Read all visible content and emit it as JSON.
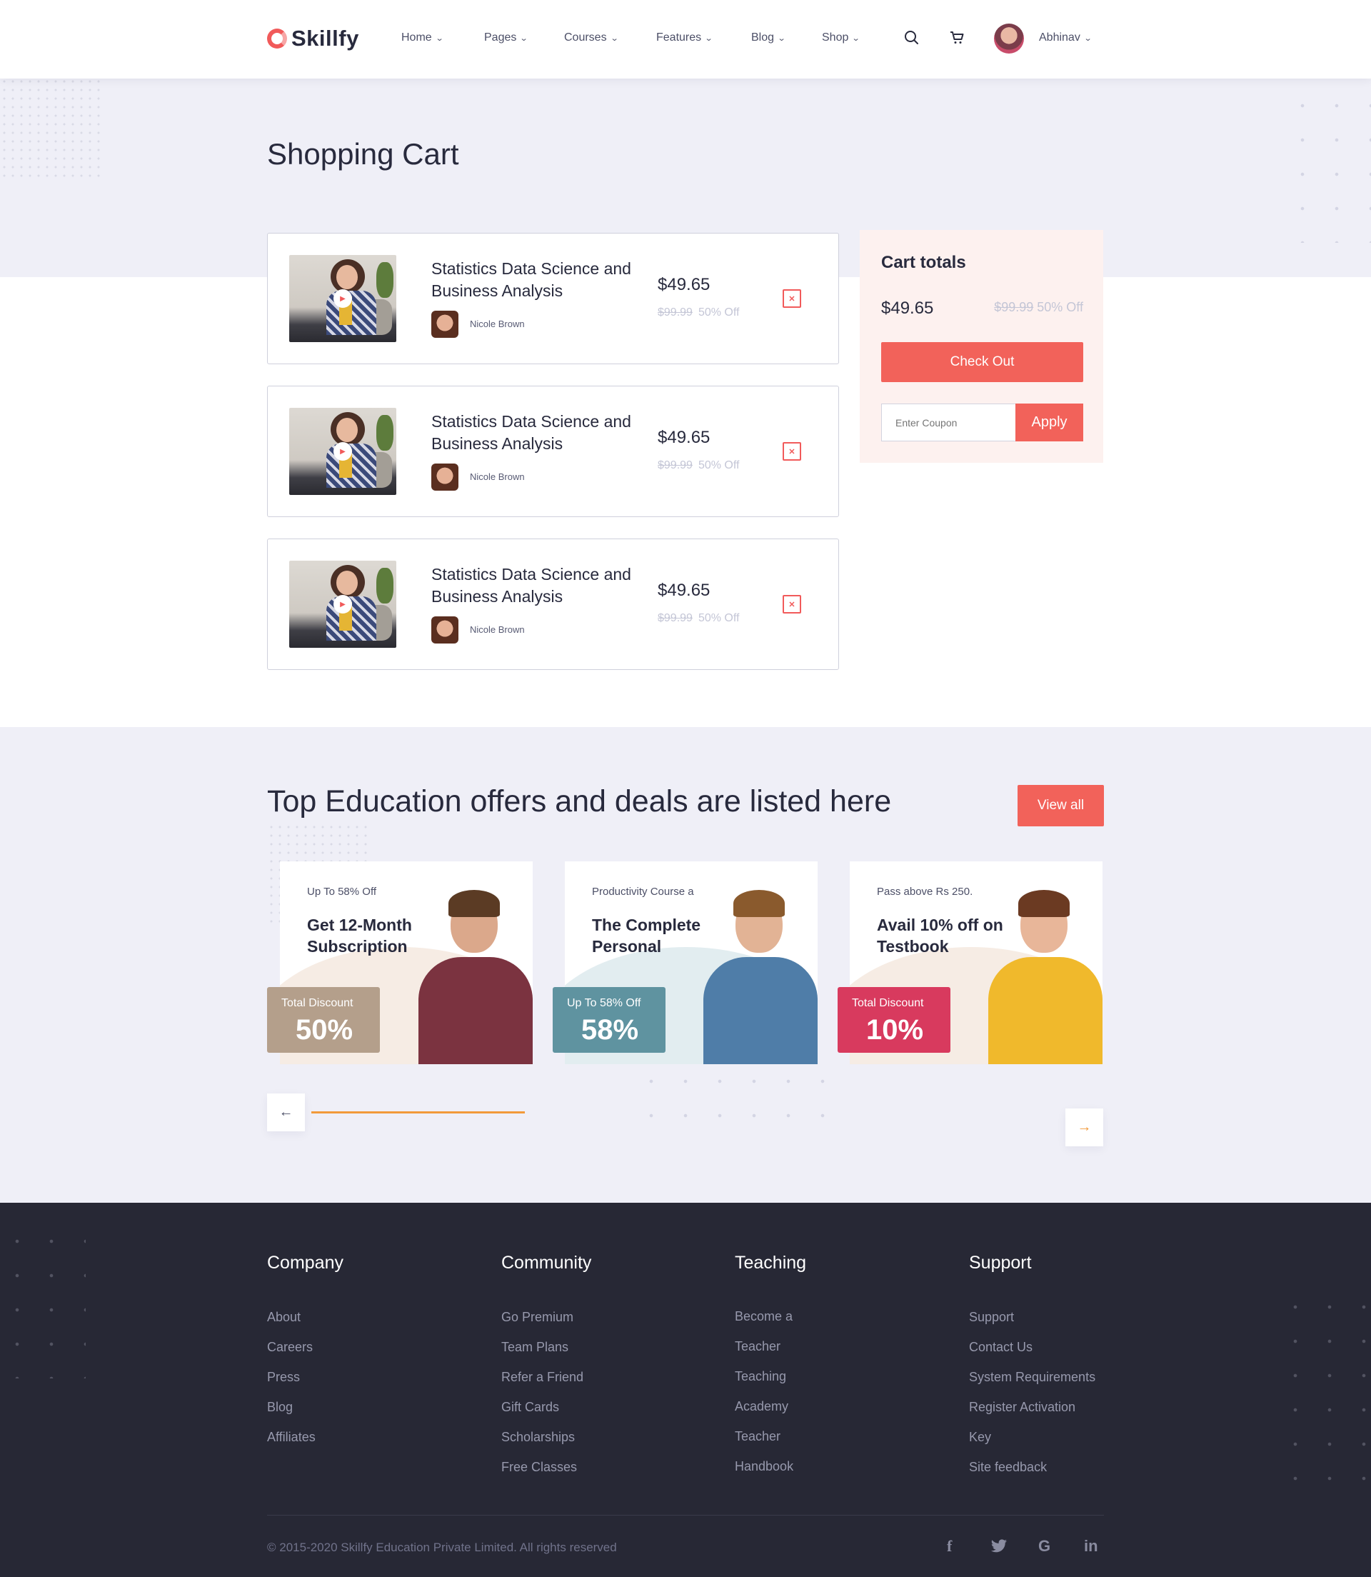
{
  "brand": {
    "name": "Skillfy",
    "accent": "#f2625a"
  },
  "nav": {
    "items": [
      {
        "label": "Home"
      },
      {
        "label": "Pages"
      },
      {
        "label": "Courses"
      },
      {
        "label": "Features"
      },
      {
        "label": "Blog"
      },
      {
        "label": "Shop"
      }
    ],
    "user_name": "Abhinav",
    "icons": [
      "search-icon",
      "cart-icon",
      "chevron-down-icon"
    ]
  },
  "page": {
    "title": "Shopping Cart"
  },
  "cart": {
    "items": [
      {
        "title": "Statistics Data Science and Business Analysis",
        "author": "Nicole Brown",
        "price": "$49.65",
        "old_price": "$99.99",
        "discount": "50% Off"
      },
      {
        "title": "Statistics Data Science and Business Analysis",
        "author": "Nicole Brown",
        "price": "$49.65",
        "old_price": "$99.99",
        "discount": "50% Off"
      },
      {
        "title": "Statistics Data Science and Business Analysis",
        "author": "Nicole Brown",
        "price": "$49.65",
        "old_price": "$99.99",
        "discount": "50% Off"
      }
    ],
    "remove_icon": "close-icon"
  },
  "totals": {
    "title": "Cart totals",
    "price": "$49.65",
    "old_price": "$99.99",
    "discount": "50% Off",
    "checkout_label": "Check Out",
    "coupon_placeholder": "Enter Coupon",
    "apply_label": "Apply"
  },
  "offers": {
    "title": "Top Education offers and deals are listed here",
    "view_all_label": "View all",
    "cards": [
      {
        "kicker": "Up To 58% Off",
        "headline": "Get 12-Month Subscription",
        "badge_label": "Total Discount",
        "badge_value": "50%",
        "badge_color": "#b49f8b"
      },
      {
        "kicker": "Productivity Course a",
        "headline": "The Complete Personal",
        "badge_label": "Up To 58% Off",
        "badge_value": "58%",
        "badge_color": "#5f93a0"
      },
      {
        "kicker": "Pass above Rs 250.",
        "headline": "Avail 10% off on Testbook",
        "badge_label": "Total Discount",
        "badge_value": "10%",
        "badge_color": "#d83a5e"
      }
    ],
    "prev_icon": "arrow-left-icon",
    "next_icon": "arrow-right-icon"
  },
  "footer": {
    "columns": [
      {
        "title": "Company",
        "links": [
          "About",
          "Careers",
          "Press",
          "Blog",
          "Affiliates"
        ]
      },
      {
        "title": "Community",
        "links": [
          "Go Premium",
          "Team Plans",
          "Refer a Friend",
          "Gift Cards",
          "Scholarships",
          "Free Classes"
        ]
      },
      {
        "title": "Teaching",
        "links": [
          "Become a",
          "Teacher",
          "Teaching",
          "Academy",
          "Teacher",
          "Handbook"
        ]
      },
      {
        "title": "Support",
        "links": [
          "Support",
          "Contact Us",
          "System Requirements",
          "Register Activation",
          "Key",
          "Site feedback"
        ]
      }
    ],
    "copyright": "© 2015-2020 Skillfy Education Private Limited. All rights reserved",
    "social": [
      {
        "icon": "facebook-icon",
        "glyph": "f"
      },
      {
        "icon": "twitter-icon",
        "glyph": "🐦"
      },
      {
        "icon": "google-icon",
        "glyph": "G"
      },
      {
        "icon": "linkedin-icon",
        "glyph": "in"
      }
    ]
  }
}
